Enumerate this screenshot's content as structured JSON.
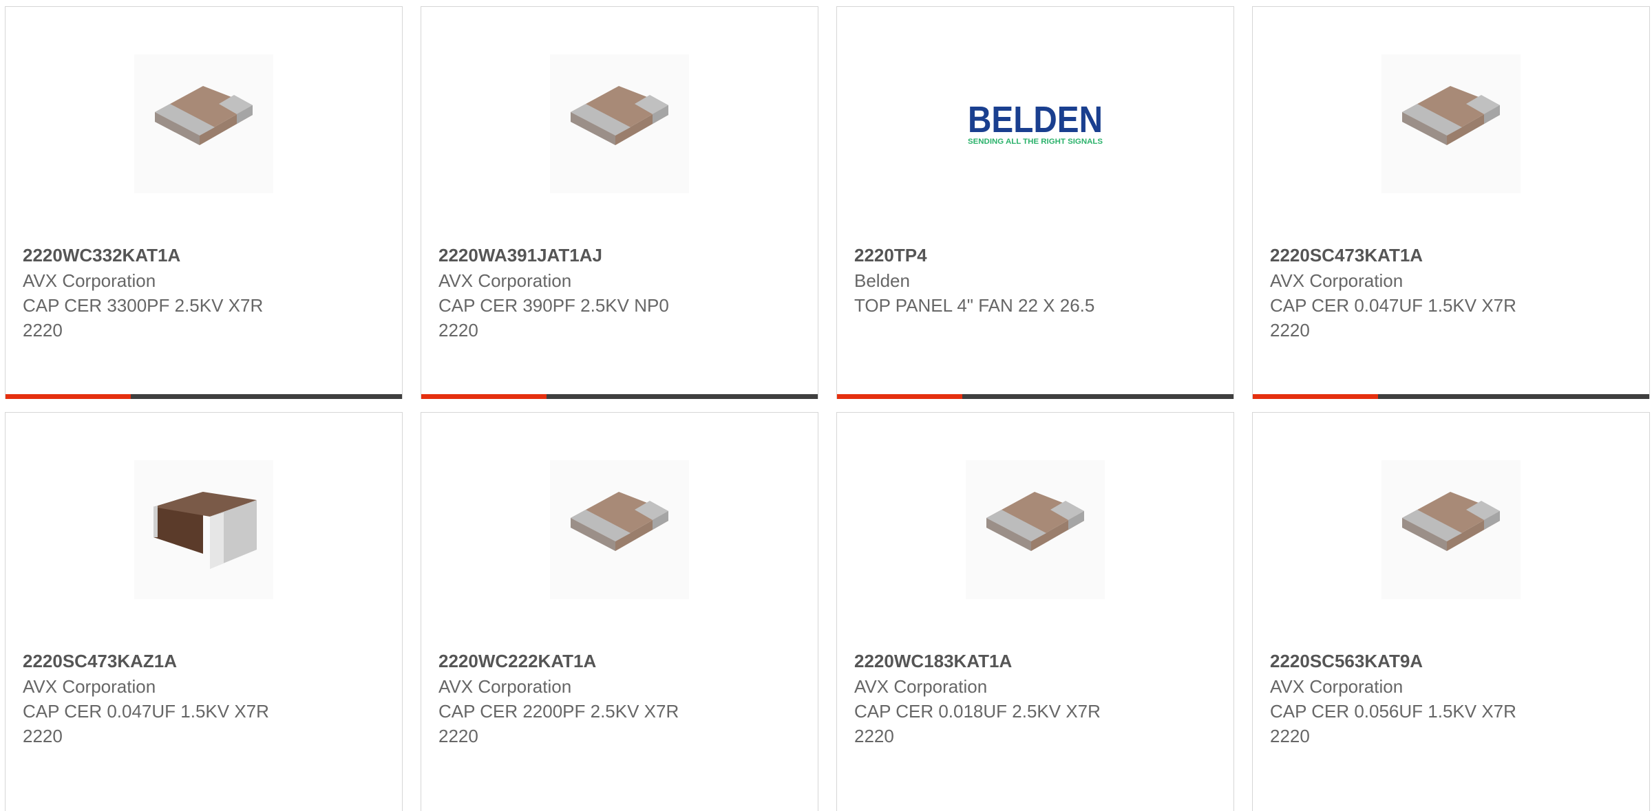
{
  "colors": {
    "accent": "#e5300f",
    "bar": "#3f3f3f",
    "border": "#d6d6d6",
    "title": "#555555",
    "text": "#666666"
  },
  "products": [
    {
      "part_number": "2220WC332KAT1A",
      "manufacturer": "AVX Corporation",
      "desc1": "CAP CER 3300PF 2.5KV X7R",
      "desc2": "2220",
      "image": "capacitor-chip-image"
    },
    {
      "part_number": "2220WA391JAT1AJ",
      "manufacturer": "AVX Corporation",
      "desc1": "CAP CER 390PF 2.5KV NP0",
      "desc2": "2220",
      "image": "capacitor-chip-image"
    },
    {
      "part_number": "2220TP4",
      "manufacturer": "Belden",
      "desc1": "TOP PANEL 4\" FAN 22 X 26.5",
      "desc2": "",
      "image": "belden-logo",
      "logo_text": "BELDEN",
      "logo_tagline": "SENDING ALL THE RIGHT SIGNALS"
    },
    {
      "part_number": "2220SC473KAT1A",
      "manufacturer": "AVX Corporation",
      "desc1": "CAP CER 0.047UF 1.5KV X7R",
      "desc2": "2220",
      "image": "capacitor-chip-image"
    },
    {
      "part_number": "2220SC473KAZ1A",
      "manufacturer": "AVX Corporation",
      "desc1": "CAP CER 0.047UF 1.5KV X7R",
      "desc2": "2220",
      "image": "capacitor-chip-dark-image"
    },
    {
      "part_number": "2220WC222KAT1A",
      "manufacturer": "AVX Corporation",
      "desc1": "CAP CER 2200PF 2.5KV X7R",
      "desc2": "2220",
      "image": "capacitor-chip-image"
    },
    {
      "part_number": "2220WC183KAT1A",
      "manufacturer": "AVX Corporation",
      "desc1": "CAP CER 0.018UF 2.5KV X7R",
      "desc2": "2220",
      "image": "capacitor-chip-image"
    },
    {
      "part_number": "2220SC563KAT9A",
      "manufacturer": "AVX Corporation",
      "desc1": "CAP CER 0.056UF 1.5KV X7R",
      "desc2": "2220",
      "image": "capacitor-chip-image"
    }
  ]
}
